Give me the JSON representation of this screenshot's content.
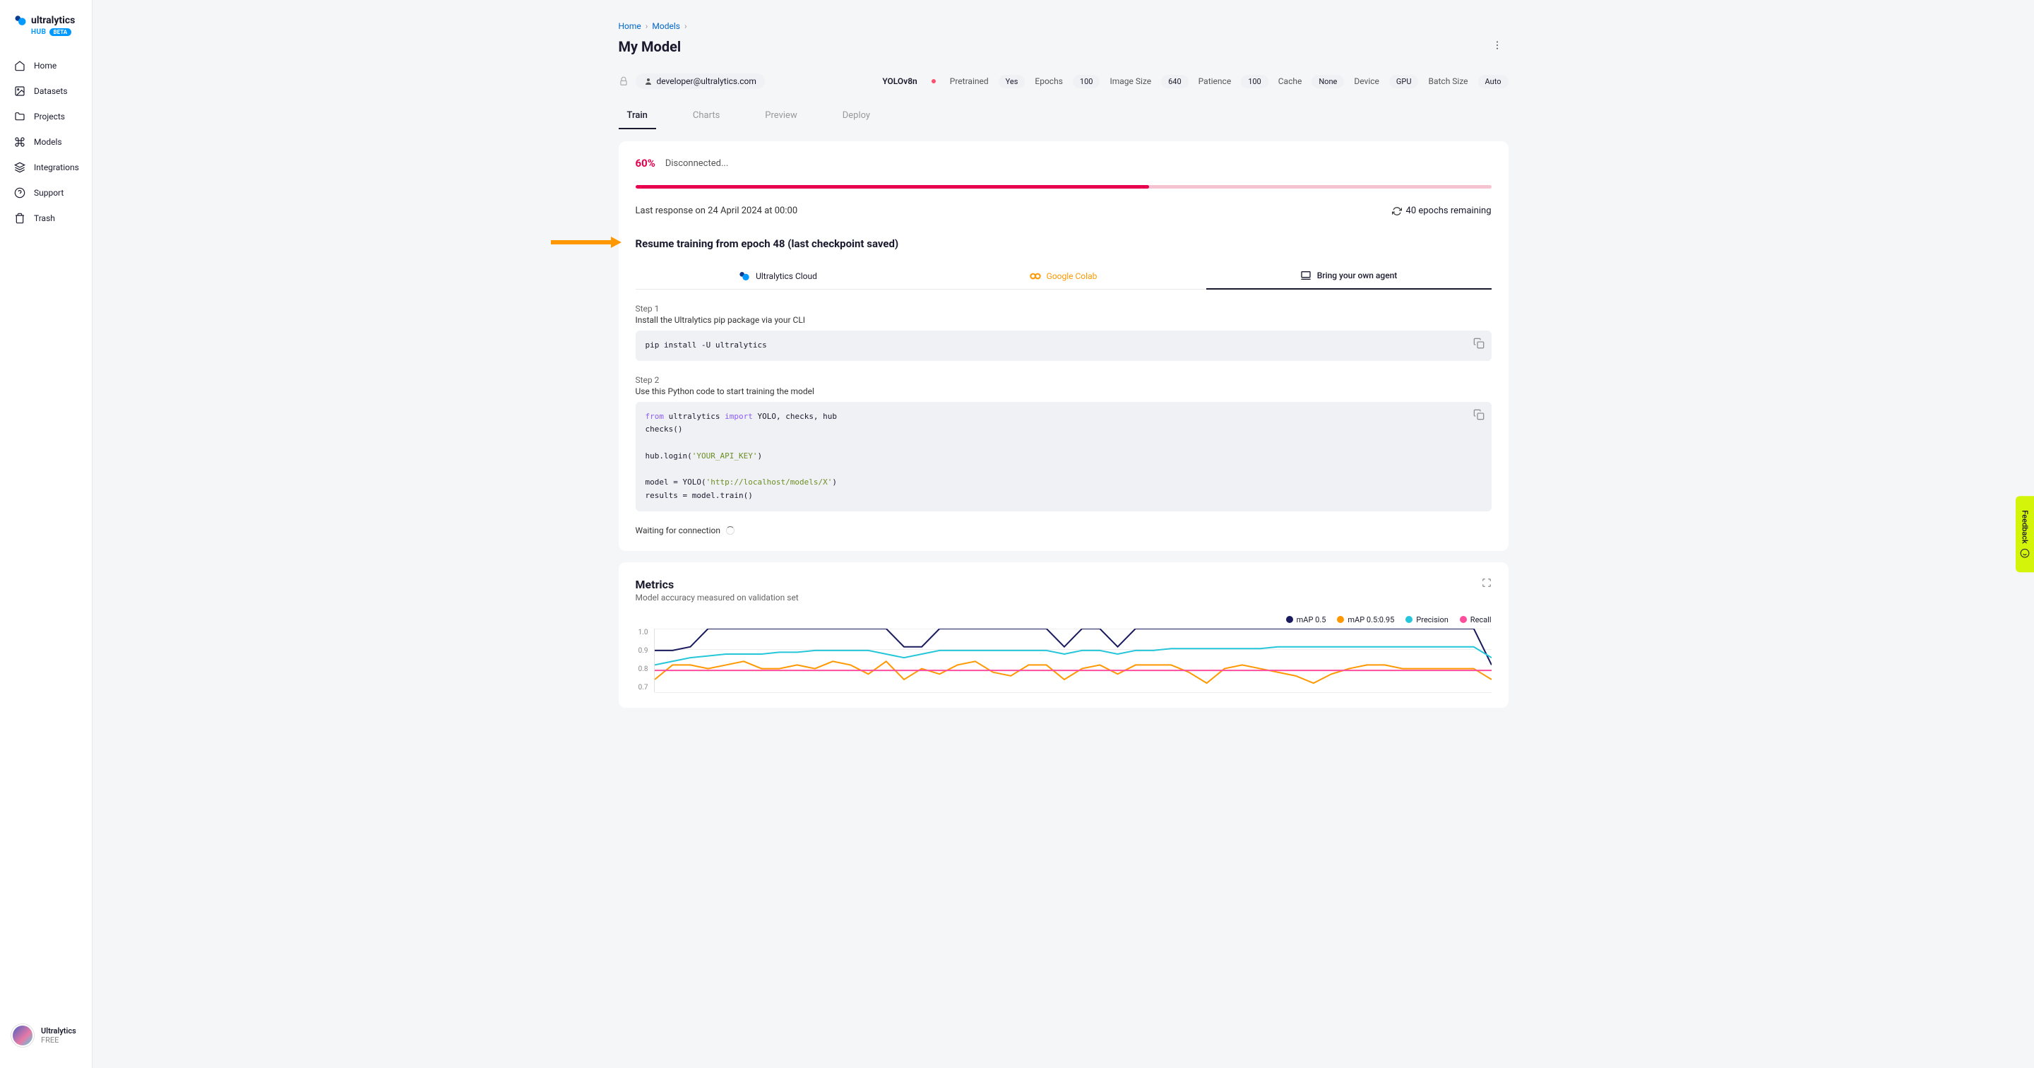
{
  "brand": {
    "name": "ultralytics",
    "sub": "HUB",
    "badge": "BETA"
  },
  "sidebar": {
    "items": [
      {
        "label": "Home",
        "icon": "home"
      },
      {
        "label": "Datasets",
        "icon": "image"
      },
      {
        "label": "Projects",
        "icon": "folder"
      },
      {
        "label": "Models",
        "icon": "command"
      },
      {
        "label": "Integrations",
        "icon": "layers"
      },
      {
        "label": "Support",
        "icon": "help"
      },
      {
        "label": "Trash",
        "icon": "trash"
      }
    ],
    "user": {
      "name": "Ultralytics",
      "plan": "FREE"
    }
  },
  "breadcrumb": {
    "home": "Home",
    "models": "Models"
  },
  "page_title": "My Model",
  "owner": "developer@ultralytics.com",
  "meta": {
    "model_name": "YOLOv8n",
    "pairs": [
      {
        "label": "Pretrained",
        "value": "Yes"
      },
      {
        "label": "Epochs",
        "value": "100"
      },
      {
        "label": "Image Size",
        "value": "640"
      },
      {
        "label": "Patience",
        "value": "100"
      },
      {
        "label": "Cache",
        "value": "None"
      },
      {
        "label": "Device",
        "value": "GPU"
      },
      {
        "label": "Batch Size",
        "value": "Auto"
      }
    ]
  },
  "tabs": [
    {
      "label": "Train",
      "active": true
    },
    {
      "label": "Charts",
      "active": false
    },
    {
      "label": "Preview",
      "active": false
    },
    {
      "label": "Deploy",
      "active": false
    }
  ],
  "training": {
    "percent": "60%",
    "percent_value": 60,
    "status": "Disconnected...",
    "last_response": "Last response on 24 April 2024 at 00:00",
    "epochs_remaining": "40 epochs remaining",
    "resume_title": "Resume training from epoch 48 (last checkpoint saved)",
    "env_tabs": [
      {
        "label": "Ultralytics Cloud",
        "active": false
      },
      {
        "label": "Google Colab",
        "active": false
      },
      {
        "label": "Bring your own agent",
        "active": true
      }
    ],
    "steps": [
      {
        "num": "Step 1",
        "desc": "Install the Ultralytics pip package via your CLI",
        "code": "pip install -U ultralytics"
      },
      {
        "num": "Step 2",
        "desc": "Use this Python code to start training the model"
      }
    ],
    "code2": {
      "line1_kw": "from",
      "line1_mid": " ultralytics ",
      "line1_kw2": "import",
      "line1_rest": " YOLO, checks, hub",
      "line2": "checks()",
      "line3_pre": "hub.login(",
      "line3_str": "'YOUR_API_KEY'",
      "line3_post": ")",
      "line4_pre": "model = YOLO(",
      "line4_str": "'http://localhost/models/X'",
      "line4_post": ")",
      "line5": "results = model.train()"
    },
    "waiting": "Waiting for connection"
  },
  "metrics": {
    "title": "Metrics",
    "subtitle": "Model accuracy measured on validation set",
    "legend": [
      {
        "label": "mAP 0.5",
        "color": "#1a1a5e"
      },
      {
        "label": "mAP 0.5:0.95",
        "color": "#ff9800"
      },
      {
        "label": "Precision",
        "color": "#26c6da"
      },
      {
        "label": "Recall",
        "color": "#ff4d9d"
      }
    ],
    "y_ticks": [
      "1.0",
      "0.9",
      "0.8",
      "0.7"
    ]
  },
  "chart_data": {
    "type": "line",
    "xlabel": "",
    "ylabel": "",
    "ylim": [
      0.65,
      1.0
    ],
    "x": [
      0,
      1,
      2,
      3,
      4,
      5,
      6,
      7,
      8,
      9,
      10,
      11,
      12,
      13,
      14,
      15,
      16,
      17,
      18,
      19,
      20,
      21,
      22,
      23,
      24,
      25,
      26,
      27,
      28,
      29,
      30,
      31,
      32,
      33,
      34,
      35,
      36,
      37,
      38,
      39,
      40,
      41,
      42,
      43,
      44,
      45,
      46,
      47
    ],
    "series": [
      {
        "name": "mAP 0.5",
        "color": "#1a1a5e",
        "values": [
          0.88,
          0.88,
          0.9,
          1.0,
          1.0,
          1.0,
          1.0,
          1.0,
          1.0,
          1.0,
          1.0,
          1.0,
          1.0,
          1.0,
          0.9,
          0.9,
          1.0,
          1.0,
          1.0,
          1.0,
          1.0,
          1.0,
          1.0,
          0.9,
          1.0,
          1.0,
          0.9,
          1.0,
          1.0,
          1.0,
          1.0,
          1.0,
          1.0,
          1.0,
          1.0,
          1.0,
          1.0,
          1.0,
          1.0,
          1.0,
          1.0,
          1.0,
          1.0,
          1.0,
          1.0,
          1.0,
          1.0,
          0.8
        ]
      },
      {
        "name": "mAP 0.5:0.95",
        "color": "#ff9800",
        "values": [
          0.72,
          0.8,
          0.8,
          0.78,
          0.8,
          0.82,
          0.78,
          0.78,
          0.8,
          0.78,
          0.82,
          0.8,
          0.75,
          0.82,
          0.72,
          0.78,
          0.75,
          0.8,
          0.82,
          0.76,
          0.74,
          0.8,
          0.8,
          0.72,
          0.78,
          0.8,
          0.75,
          0.8,
          0.8,
          0.8,
          0.76,
          0.7,
          0.78,
          0.8,
          0.78,
          0.76,
          0.74,
          0.7,
          0.75,
          0.78,
          0.8,
          0.8,
          0.78,
          0.78,
          0.78,
          0.78,
          0.78,
          0.72
        ]
      },
      {
        "name": "Precision",
        "color": "#26c6da",
        "values": [
          0.8,
          0.82,
          0.84,
          0.85,
          0.86,
          0.86,
          0.86,
          0.87,
          0.87,
          0.88,
          0.88,
          0.88,
          0.88,
          0.86,
          0.84,
          0.86,
          0.88,
          0.88,
          0.88,
          0.88,
          0.88,
          0.88,
          0.88,
          0.86,
          0.88,
          0.88,
          0.86,
          0.88,
          0.88,
          0.89,
          0.89,
          0.89,
          0.89,
          0.89,
          0.89,
          0.9,
          0.9,
          0.9,
          0.9,
          0.9,
          0.9,
          0.9,
          0.9,
          0.9,
          0.9,
          0.9,
          0.9,
          0.84
        ]
      },
      {
        "name": "Recall",
        "color": "#ff4d9d",
        "values": [
          0.77,
          0.77,
          0.77,
          0.77,
          0.77,
          0.77,
          0.77,
          0.77,
          0.77,
          0.77,
          0.77,
          0.77,
          0.77,
          0.77,
          0.77,
          0.77,
          0.77,
          0.77,
          0.77,
          0.77,
          0.77,
          0.77,
          0.77,
          0.77,
          0.77,
          0.77,
          0.77,
          0.77,
          0.77,
          0.77,
          0.77,
          0.77,
          0.77,
          0.77,
          0.77,
          0.77,
          0.77,
          0.77,
          0.77,
          0.77,
          0.77,
          0.77,
          0.77,
          0.77,
          0.77,
          0.77,
          0.77,
          0.77
        ]
      }
    ]
  },
  "feedback_label": "Feedback"
}
